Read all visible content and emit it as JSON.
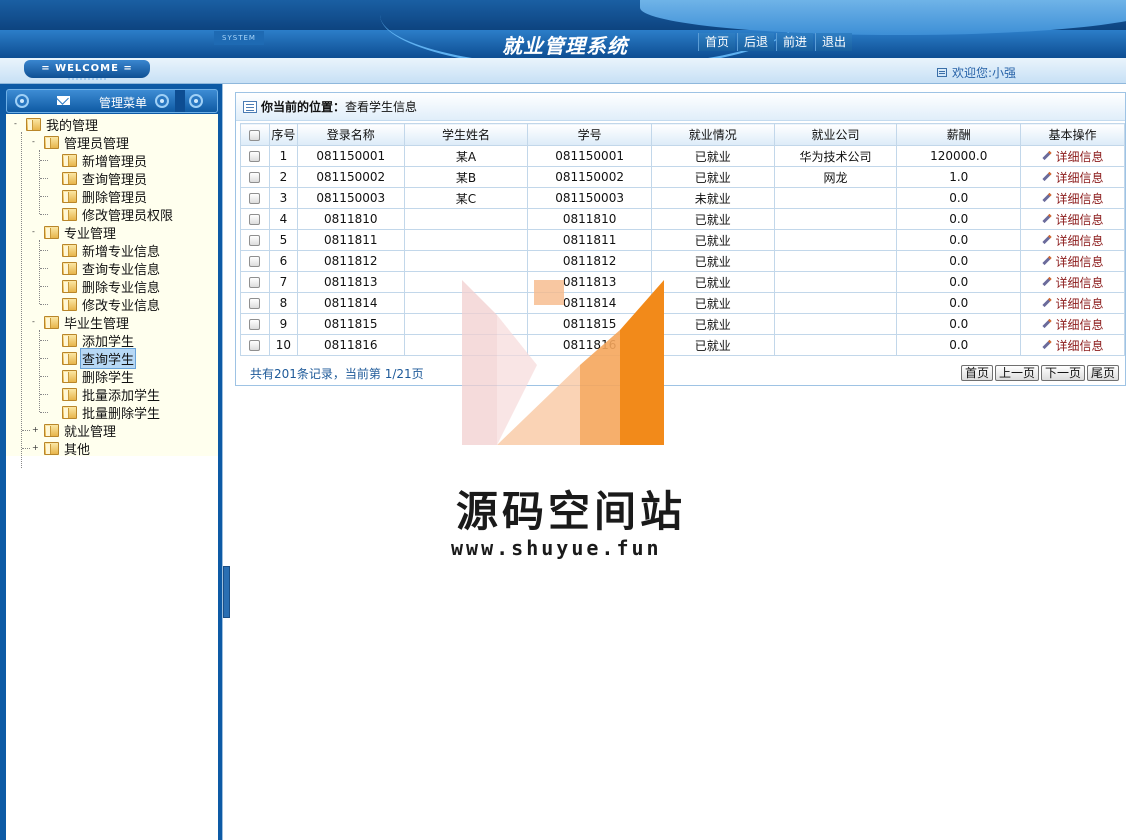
{
  "header": {
    "system_tag": "SYSTEM",
    "title": "就业管理系统",
    "nav": [
      "首页",
      "后退",
      "前进",
      "退出"
    ]
  },
  "subbar": {
    "welcome": "= WELCOME =",
    "greeting": "欢迎您:小强"
  },
  "sidebar": {
    "title": "管理菜单",
    "tree": {
      "root": "我的管理",
      "groups": [
        {
          "label": "管理员管理",
          "items": [
            "新增管理员",
            "查询管理员",
            "删除管理员",
            "修改管理员权限"
          ]
        },
        {
          "label": "专业管理",
          "items": [
            "新增专业信息",
            "查询专业信息",
            "删除专业信息",
            "修改专业信息"
          ]
        },
        {
          "label": "毕业生管理",
          "items": [
            "添加学生",
            "查询学生",
            "删除学生",
            "批量添加学生",
            "批量删除学生"
          ]
        },
        {
          "label": "就业管理",
          "items": []
        },
        {
          "label": "其他",
          "items": []
        }
      ],
      "selected": "查询学生"
    }
  },
  "main": {
    "location_label": "你当前的位置：",
    "location_value": "查看学生信息",
    "columns": [
      "序号",
      "登录名称",
      "学生姓名",
      "学号",
      "就业情况",
      "就业公司",
      "薪酬",
      "基本操作"
    ],
    "rows": [
      {
        "no": "1",
        "login": "081150001",
        "name": "某A",
        "sid": "081150001",
        "status": "已就业",
        "company": "华为技术公司",
        "salary": "120000.0",
        "action": "详细信息"
      },
      {
        "no": "2",
        "login": "081150002",
        "name": "某B",
        "sid": "081150002",
        "status": "已就业",
        "company": "网龙",
        "salary": "1.0",
        "action": "详细信息"
      },
      {
        "no": "3",
        "login": "081150003",
        "name": "某C",
        "sid": "081150003",
        "status": "未就业",
        "company": "",
        "salary": "0.0",
        "action": "详细信息"
      },
      {
        "no": "4",
        "login": "0811810",
        "name": "",
        "sid": "0811810",
        "status": "已就业",
        "company": "",
        "salary": "0.0",
        "action": "详细信息"
      },
      {
        "no": "5",
        "login": "0811811",
        "name": "",
        "sid": "0811811",
        "status": "已就业",
        "company": "",
        "salary": "0.0",
        "action": "详细信息"
      },
      {
        "no": "6",
        "login": "0811812",
        "name": "",
        "sid": "0811812",
        "status": "已就业",
        "company": "",
        "salary": "0.0",
        "action": "详细信息"
      },
      {
        "no": "7",
        "login": "0811813",
        "name": "",
        "sid": "0811813",
        "status": "已就业",
        "company": "",
        "salary": "0.0",
        "action": "详细信息"
      },
      {
        "no": "8",
        "login": "0811814",
        "name": "",
        "sid": "0811814",
        "status": "已就业",
        "company": "",
        "salary": "0.0",
        "action": "详细信息"
      },
      {
        "no": "9",
        "login": "0811815",
        "name": "",
        "sid": "0811815",
        "status": "已就业",
        "company": "",
        "salary": "0.0",
        "action": "详细信息"
      },
      {
        "no": "10",
        "login": "0811816",
        "name": "",
        "sid": "0811816",
        "status": "已就业",
        "company": "",
        "salary": "0.0",
        "action": "详细信息"
      }
    ],
    "pager_info": "共有201条记录，当前第 1/21页",
    "pager_buttons": [
      "首页",
      "上一页",
      "下一页",
      "尾页"
    ]
  },
  "watermark": {
    "title": "源码空间站",
    "url": "www.shuyue.fun"
  },
  "colors": {
    "header_blue": "#0b3f7a",
    "link_red": "#8b1a1a",
    "watermark_orange": "#f28a1a"
  }
}
